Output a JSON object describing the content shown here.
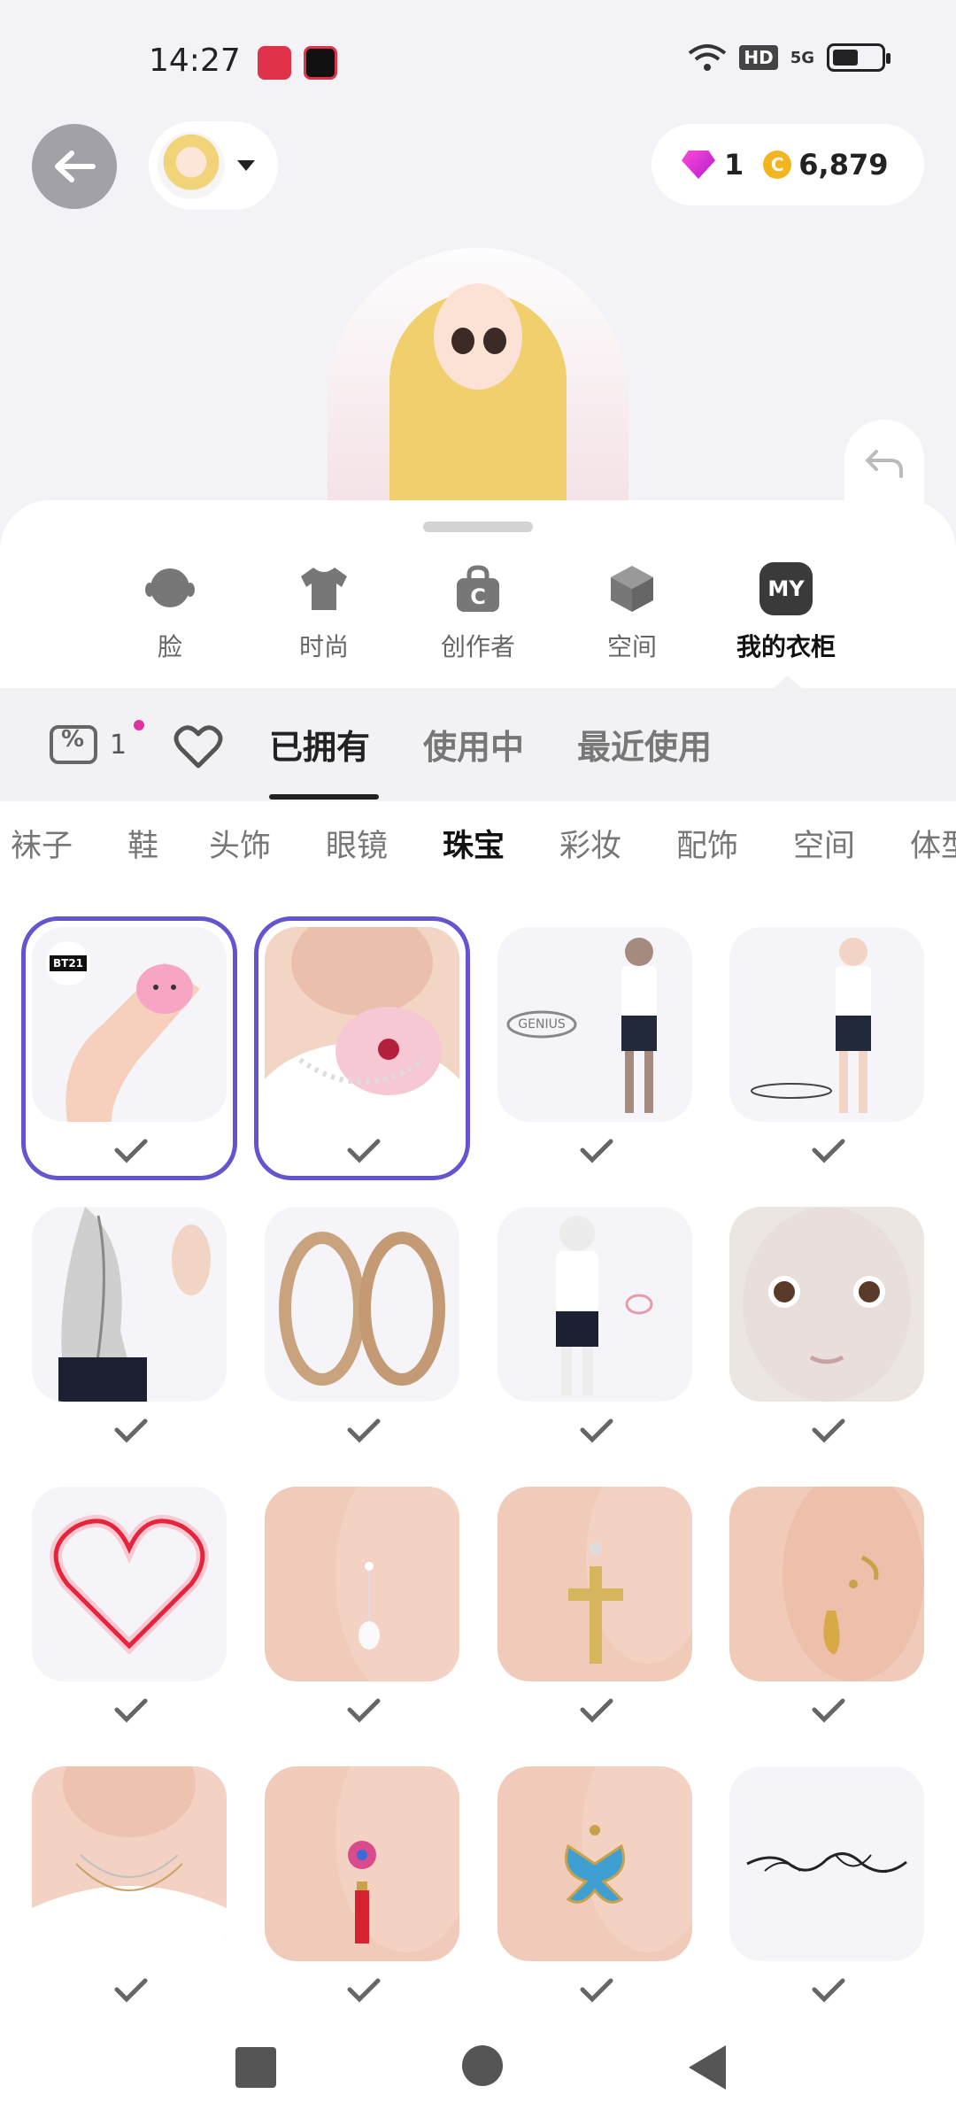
{
  "status": {
    "time": "14:27",
    "hd": "HD",
    "network": "5G"
  },
  "header": {
    "gems": "1",
    "coins": "6,879"
  },
  "categories": [
    {
      "label": "脸",
      "icon": "face-icon"
    },
    {
      "label": "时尚",
      "icon": "tshirt-icon"
    },
    {
      "label": "创作者",
      "icon": "shopping-bag-icon"
    },
    {
      "label": "空间",
      "icon": "cube-icon"
    },
    {
      "label": "我的衣柜",
      "icon": "my-closet-icon",
      "badge": "MY",
      "active": true
    }
  ],
  "filters": {
    "coupon_count": "1",
    "tabs": [
      "已拥有",
      "使用中",
      "最近使用"
    ],
    "active_tab": "已拥有"
  },
  "subcategories": [
    "袜子",
    "鞋",
    "头饰",
    "眼镜",
    "珠宝",
    "彩妆",
    "配饰",
    "空间",
    "体型"
  ],
  "active_subcategory": "珠宝",
  "items": [
    {
      "name": "bt21-bracelet",
      "tag": "BT21",
      "selected": true
    },
    {
      "name": "pearl-bow-choker",
      "selected": true
    },
    {
      "name": "genius-halo",
      "text": "GENIUS"
    },
    {
      "name": "ground-ring"
    },
    {
      "name": "silver-hair-earring"
    },
    {
      "name": "gold-hoop-earrings"
    },
    {
      "name": "pink-ring-item"
    },
    {
      "name": "face-item"
    },
    {
      "name": "neon-heart"
    },
    {
      "name": "pearl-drop-earring"
    },
    {
      "name": "cross-earring"
    },
    {
      "name": "gold-ear-cuff"
    },
    {
      "name": "layered-necklace"
    },
    {
      "name": "tassel-earring"
    },
    {
      "name": "butterfly-earring"
    },
    {
      "name": "script-name-necklace"
    }
  ],
  "colors": {
    "accent": "#6454cf",
    "gem": "#d926d6",
    "coin": "#f3b51f"
  }
}
